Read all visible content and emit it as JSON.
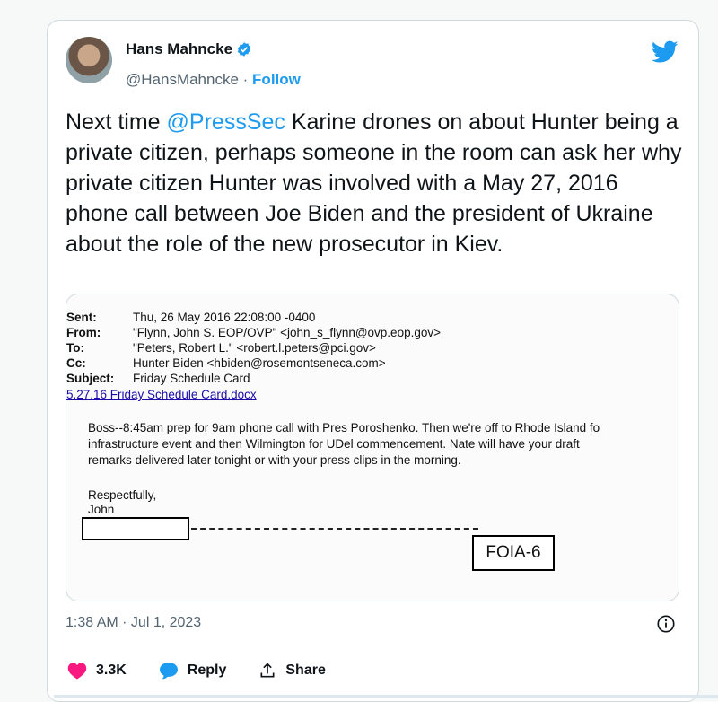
{
  "author": {
    "display_name": "Hans Mahncke",
    "handle": "@HansMahncke",
    "separator": " · ",
    "follow_label": "Follow"
  },
  "tweet": {
    "text_before": "Next time ",
    "mention": "@PressSec",
    "text_after": " Karine drones on about Hunter being a private citizen, perhaps someone in the room can ask her why private citizen Hunter was involved with a May 27, 2016 phone call between Joe Biden and the president of Ukraine about the role of the new prosecutor in Kiev."
  },
  "email": {
    "headers": [
      {
        "key": "Sent:",
        "value": "Thu, 26 May 2016 22:08:00 -0400"
      },
      {
        "key": "From:",
        "value": "\"Flynn, John S. EOP/OVP\" <john_s_flynn@ovp.eop.gov>"
      },
      {
        "key": "To:",
        "value": "\"Peters, Robert L.\" <robert.l.peters@pci.gov>"
      },
      {
        "key": "Cc:",
        "value": "Hunter Biden <hbiden@rosemontseneca.com>"
      },
      {
        "key": "Subject:",
        "value": "Friday Schedule Card"
      }
    ],
    "attachment": "5.27.16 Friday Schedule Card.docx",
    "body_lines": [
      "Boss--8:45am prep for 9am phone call with Pres Poroshenko. Then we're off to Rhode Island fo",
      "infrastructure event and then Wilmington for UDel commencement. Nate will have your draft",
      "remarks delivered later tonight or with your press clips in the morning."
    ],
    "sign_off": "Respectfully,",
    "signature": "John",
    "stamp": "FOIA-6"
  },
  "meta": {
    "timestamp": "1:38 AM · Jul 1, 2023"
  },
  "actions": {
    "like_count": "3.3K",
    "reply_label": "Reply",
    "share_label": "Share"
  },
  "colors": {
    "accent": "#1d9bf0",
    "like": "#f91880",
    "text": "#0f1419",
    "muted": "#536471"
  }
}
